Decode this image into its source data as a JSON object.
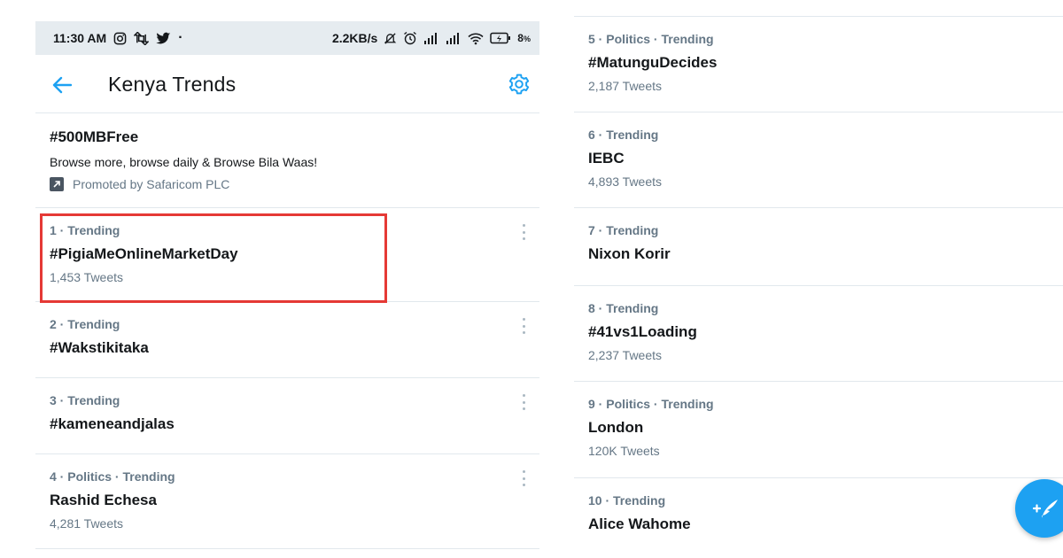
{
  "status_bar": {
    "time": "11:30 AM",
    "network_speed": "2.2KB/s",
    "battery_percent": "8",
    "battery_unit": "%",
    "left_icons": [
      "instagram-icon",
      "retweet-icon",
      "twitter-bird-icon",
      "dot-icon"
    ],
    "right_icons": [
      "mute-icon",
      "alarm-icon",
      "signal-icon",
      "signal-icon",
      "wifi-icon",
      "battery-charging-icon"
    ]
  },
  "header": {
    "title": "Kenya Trends",
    "back_icon": "arrow-left-icon",
    "settings_icon": "gear-icon"
  },
  "promoted": {
    "topic": "#500MBFree",
    "description": "Browse more, browse daily & Browse Bila Waas!",
    "promoted_by": "Promoted by Safaricom PLC",
    "icon": "promoted-arrow-icon"
  },
  "trends_left": [
    {
      "meta": "1 · Trending",
      "topic": "#PigiaMeOnlineMarketDay",
      "count": "1,453 Tweets",
      "highlighted": true
    },
    {
      "meta": "2 · Trending",
      "topic": "#Wakstikitaka",
      "count": ""
    },
    {
      "meta": "3 · Trending",
      "topic": "#kameneandjalas",
      "count": ""
    },
    {
      "meta": "4 · Politics · Trending",
      "topic": "Rashid Echesa",
      "count": "4,281 Tweets"
    }
  ],
  "trends_right": [
    {
      "meta": "5 · Politics · Trending",
      "topic": "#MatunguDecides",
      "count": "2,187 Tweets"
    },
    {
      "meta": "6 · Trending",
      "topic": "IEBC",
      "count": "4,893 Tweets"
    },
    {
      "meta": "7 · Trending",
      "topic": "Nixon Korir",
      "count": ""
    },
    {
      "meta": "8 · Trending",
      "topic": "#41vs1Loading",
      "count": "2,237 Tweets"
    },
    {
      "meta": "9 · Politics · Trending",
      "topic": "London",
      "count": "120K Tweets"
    },
    {
      "meta": "10 · Trending",
      "topic": "Alice Wahome",
      "count": ""
    }
  ],
  "fab": {
    "icon": "compose-tweet-icon"
  },
  "colors": {
    "accent": "#1da1f2",
    "highlight": "#e53935",
    "secondary_text": "#657786",
    "status_bar_bg": "#e6ecf0"
  }
}
